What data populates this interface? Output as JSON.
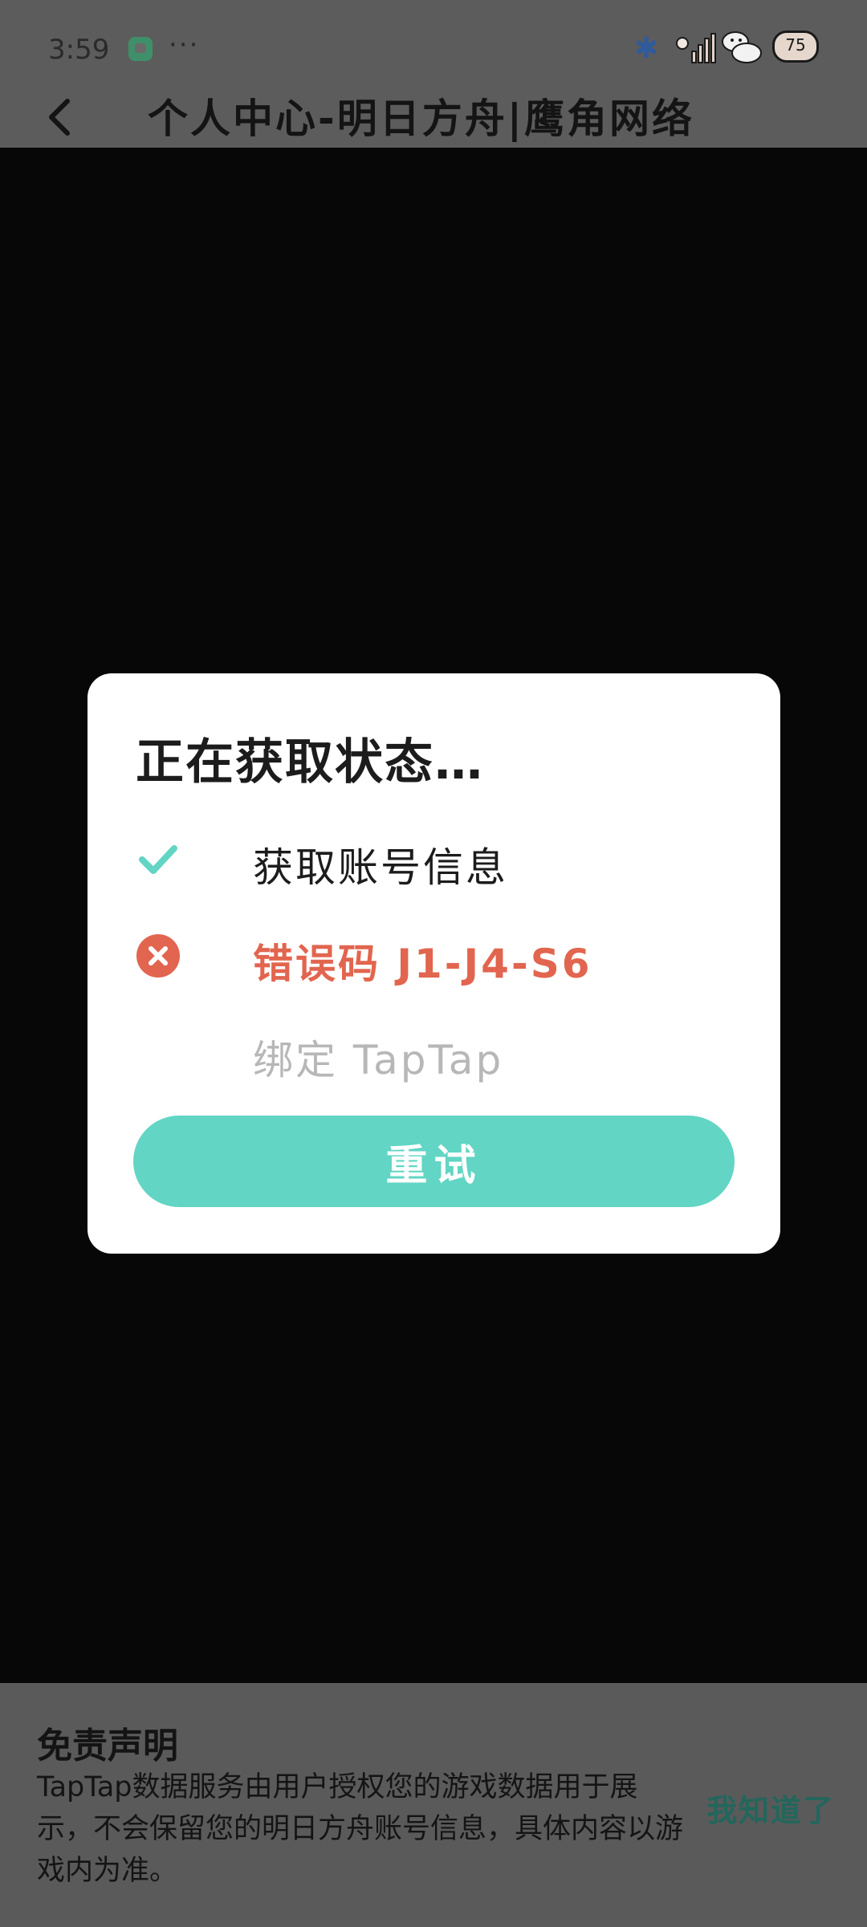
{
  "status_bar": {
    "time": "3:59",
    "more": "···",
    "battery": "75"
  },
  "header": {
    "title": "个人中心-明日方舟|鹰角网络"
  },
  "dialog": {
    "title": "正在获取状态…",
    "steps": [
      {
        "label": "获取账号信息",
        "state": "done",
        "icon": "check-icon"
      },
      {
        "label": "错误码 J1-J4-S6",
        "state": "error",
        "icon": "error-circle-icon"
      },
      {
        "label": "绑定 TapTap",
        "state": "pending"
      }
    ],
    "retry_label": "重试"
  },
  "disclaimer": {
    "title": "免责声明",
    "body": "TapTap数据服务由用户授权您的游戏数据用于展示，不会保留您的明日方舟账号信息，具体内容以游戏内为准。",
    "ack_label": "我知道了"
  },
  "colors": {
    "accent": "#62d5c4",
    "error": "#e2654f",
    "ack": "#23665c"
  }
}
